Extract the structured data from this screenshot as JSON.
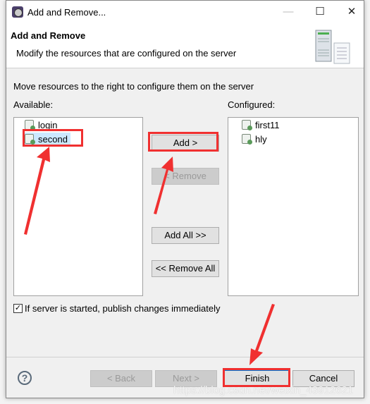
{
  "window": {
    "title": "Add and Remove...",
    "minimize": "—",
    "maximize": "☐",
    "close": "✕"
  },
  "header": {
    "title": "Add and Remove",
    "description": "Modify the resources that are configured on the server"
  },
  "instruction": "Move resources to the right to configure them on the server",
  "available": {
    "label": "Available:",
    "items": [
      {
        "label": "login",
        "selected": false
      },
      {
        "label": "second",
        "selected": true
      }
    ]
  },
  "configured": {
    "label": "Configured:",
    "items": [
      {
        "label": "first11"
      },
      {
        "label": "hly"
      }
    ]
  },
  "buttons": {
    "add": "Add >",
    "remove": "< Remove",
    "add_all": "Add All >>",
    "remove_all": "<< Remove All",
    "back": "< Back",
    "next": "Next >",
    "finish": "Finish",
    "cancel": "Cancel",
    "help": "?"
  },
  "publish": {
    "label": "If server is started, publish changes immediately",
    "checked": true,
    "mark": "✓"
  },
  "watermark": "https://blog.csdn.net/weixin_43912621",
  "annotation_color": "#f03030"
}
